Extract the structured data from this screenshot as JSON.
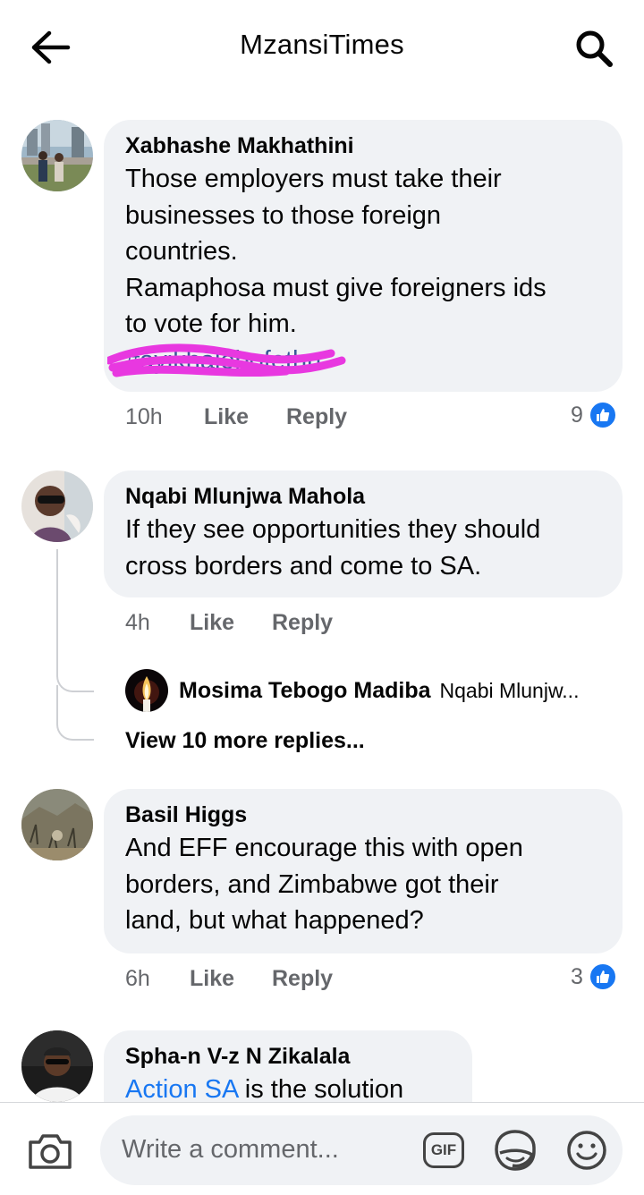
{
  "header": {
    "title": "MzansiTimes",
    "back_icon": "arrow-left-icon",
    "search_icon": "search-icon"
  },
  "comments": [
    {
      "author": "Xabhashe Makhathini",
      "text_lines": [
        "Those employers must take their",
        "businesses to those foreign",
        "countries.",
        "Ramaphosa must give foreigners ids",
        "to vote for him.",
        "#ayikhalebofethu."
      ],
      "time": "10h",
      "like_label": "Like",
      "reply_label": "Reply",
      "reaction_count": "9"
    },
    {
      "author": "Nqabi Mlunjwa Mahola",
      "text_lines": [
        "If they see opportunities they should",
        "cross borders and come to SA."
      ],
      "time": "4h",
      "like_label": "Like",
      "reply_label": "Reply",
      "reply_preview": {
        "author": "Mosima Tebogo Madiba",
        "snippet": "Nqabi Mlunjw..."
      },
      "view_more": "View 10 more replies..."
    },
    {
      "author": "Basil Higgs",
      "text_lines": [
        "And EFF encourage this with open",
        "borders, and Zimbabwe got their",
        "land, but what happened?"
      ],
      "time": "6h",
      "like_label": "Like",
      "reply_label": "Reply",
      "reaction_count": "3"
    },
    {
      "author": "Spha-n V-z N Zikalala",
      "link_text": "Action SA",
      "text_rest": " is the solution"
    }
  ],
  "composer": {
    "placeholder": "Write a comment...",
    "gif_label": "GIF",
    "camera_icon": "camera-icon",
    "sticker_icon": "sticker-icon",
    "emoji_icon": "smiley-icon"
  },
  "colors": {
    "accent": "#1877f2",
    "bubble": "#f0f2f5",
    "meta_text": "#65676b",
    "scribble": "#e838e0"
  }
}
